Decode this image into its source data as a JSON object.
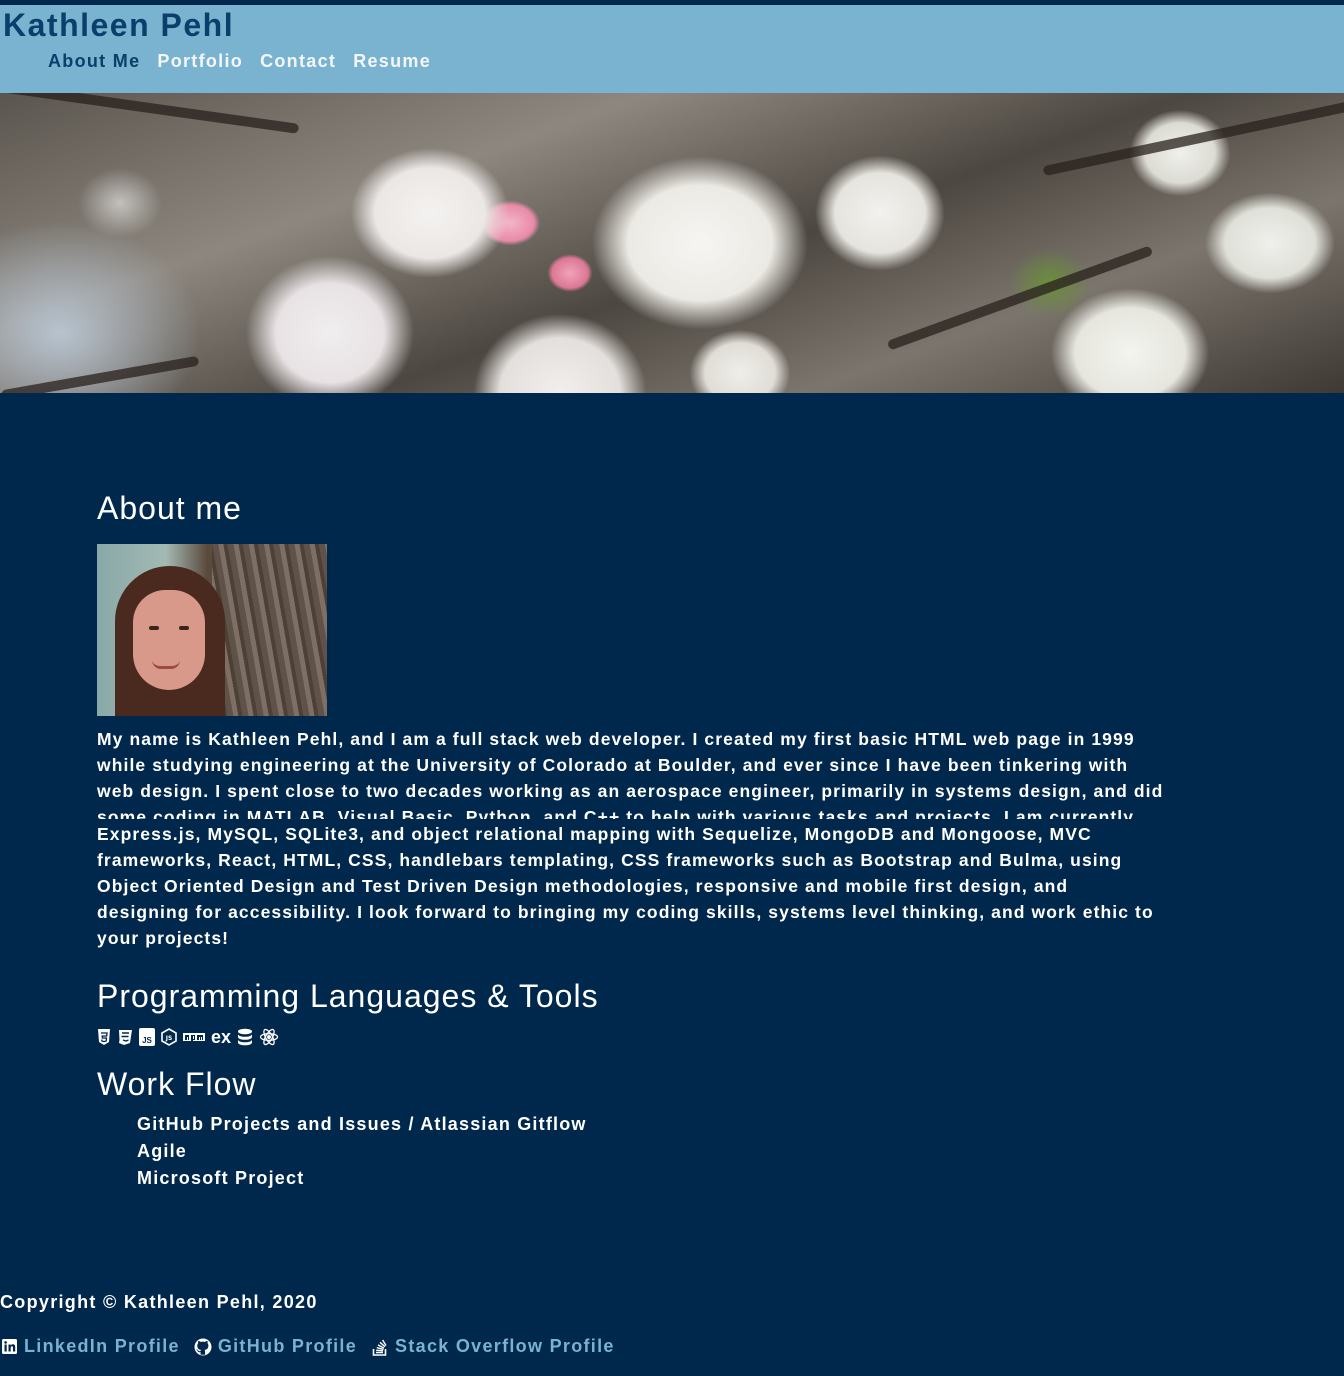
{
  "header": {
    "site_title": "Kathleen Pehl",
    "nav": [
      {
        "label": "About Me",
        "active": true
      },
      {
        "label": "Portfolio"
      },
      {
        "label": "Contact"
      },
      {
        "label": "Resume"
      }
    ]
  },
  "about": {
    "title": "About me",
    "bio_lines": [
      "My name is Kathleen Pehl, and I am a full stack web developer. I created my first basic HTML web page in 1999",
      "while studying engineering at the University of Colorado at Boulder, and ever since I have been tinkering with",
      "web design. I spent close to two decades working as an aerospace engineer, primarily in systems design, and did",
      "some coding in MATLAB, Visual Basic, Python, and C++ to help with various tasks and projects. I am currently",
      "Express.js, MySQL, SQLite3, and object relational mapping with Sequelize, MongoDB and Mongoose, MVC",
      "frameworks, React, HTML, CSS, handlebars templating, CSS frameworks such as Bootstrap and Bulma, using",
      "Object Oriented Design and Test Driven Design methodologies, responsive and mobile first design, and",
      "designing for accessibility. I look forward to bringing my coding skills, systems level thinking, and work ethic to",
      "your projects!"
    ]
  },
  "languages": {
    "title": "Programming Languages & Tools",
    "icons": [
      "html5-icon",
      "css3-icon",
      "javascript-icon",
      "nodejs-icon",
      "npm-icon",
      "express-icon",
      "database-icon",
      "react-icon"
    ],
    "icon_labels": {
      "javascript": "JS",
      "npm": "npm",
      "express": "ex"
    }
  },
  "workflow": {
    "title": "Work Flow",
    "items": [
      "GitHub Projects and Issues / Atlassian Gitflow",
      "Agile",
      "Microsoft Project"
    ]
  },
  "footer": {
    "copyright": "Copyright © Kathleen Pehl, 2020",
    "links": [
      {
        "label": "LinkedIn Profile",
        "icon": "linkedin-icon"
      },
      {
        "label": "GitHub Profile",
        "icon": "github-icon"
      },
      {
        "label": "Stack Overflow Profile",
        "icon": "stackoverflow-icon"
      }
    ]
  },
  "colors": {
    "background": "#00284c",
    "header": "#7ab3d0",
    "title": "#0b3f6b",
    "link": "#7ab3d0"
  }
}
